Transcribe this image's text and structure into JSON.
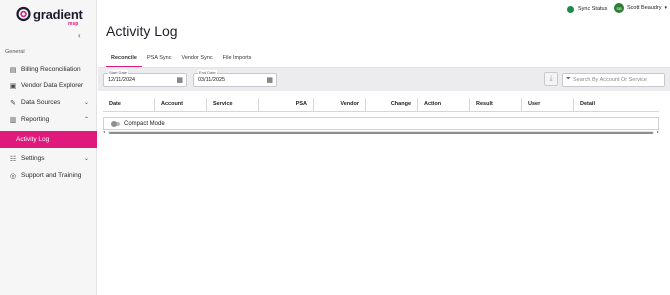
{
  "brand": {
    "name": "gradient",
    "sub": "msp"
  },
  "sidebar": {
    "collapse_icon": "chevron-left-icon",
    "section": "General",
    "items": [
      {
        "label": "Billing Reconciliation",
        "icon": "billing-icon"
      },
      {
        "label": "Vendor Data Explorer",
        "icon": "explorer-icon"
      },
      {
        "label": "Data Sources",
        "icon": "plug-icon",
        "expandable": true
      },
      {
        "label": "Reporting",
        "icon": "report-icon",
        "expanded": true
      },
      {
        "label": "Activity Log",
        "active": true
      },
      {
        "label": "Settings",
        "icon": "settings-icon",
        "expandable": true
      },
      {
        "label": "Support and Training",
        "icon": "support-icon"
      }
    ]
  },
  "topbar": {
    "sync_label": "Sync Status",
    "sync_color": "#1b8a4a",
    "user_name": "Scott Beaudry",
    "user_initials": "SB"
  },
  "page": {
    "title": "Activity Log"
  },
  "tabs": [
    "Reconcile",
    "PSA Sync",
    "Vendor Sync",
    "File Imports"
  ],
  "filters": {
    "start_label": "Start Date",
    "start_value": "12/11/2024",
    "end_label": "End Date",
    "end_value": "03/11/2025",
    "search_placeholder": "Search By Account Or Service"
  },
  "table": {
    "columns": [
      "Date",
      "Account",
      "Service",
      "PSA",
      "Vendor",
      "Change",
      "Action",
      "Result",
      "User",
      "Detail"
    ],
    "compact_label": "Compact Mode"
  },
  "colors": {
    "accent": "#e0197d",
    "sidebar_bg": "#f6f6f7"
  }
}
